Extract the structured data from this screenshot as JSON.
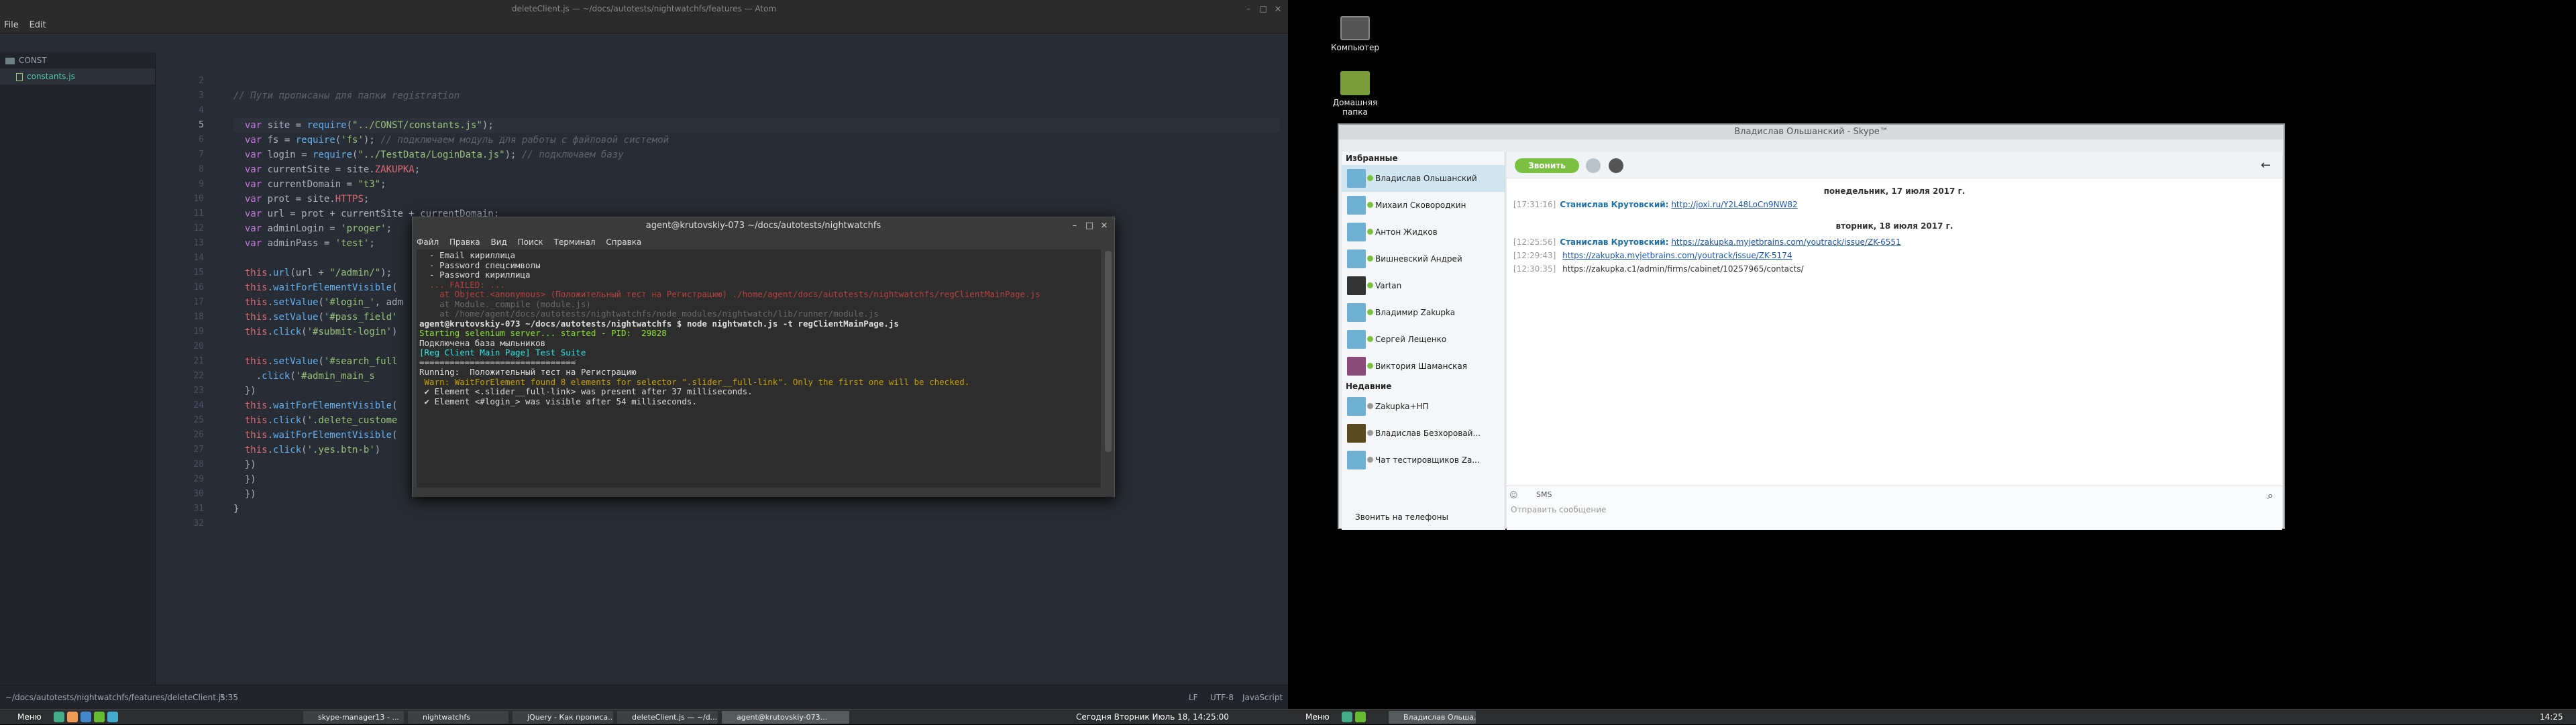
{
  "atom": {
    "title": "deleteClient.js — ~/docs/autotests/nightwatchfs/features — Atom",
    "menu": [
      "File",
      "Edit"
    ],
    "tree": {
      "folder": "CONST",
      "file": "constants.js"
    },
    "line_numbers": [
      "2",
      "3",
      "4",
      "5",
      "6",
      "7",
      "8",
      "9",
      "10",
      "11",
      "12",
      "13",
      "14",
      "15",
      "16",
      "17",
      "18",
      "19",
      "20",
      "21",
      "22",
      "23",
      "24",
      "25",
      "26",
      "27",
      "28",
      "29",
      "30",
      "31",
      "32"
    ],
    "status": {
      "path": "~/docs/autotests/nightwatchfs/features/deleteClient.js",
      "pos": "5:35",
      "eol": "LF",
      "enc": "UTF-8",
      "grammar": "JavaScript"
    }
  },
  "terminal": {
    "title": "agent@krutovskiy-073 ~/docs/autotests/nightwatchfs",
    "menu": [
      "Файл",
      "Правка",
      "Вид",
      "Поиск",
      "Терминал",
      "Справка"
    ],
    "lines": [
      "  - Email кириллица",
      "  - Password спецсимволы",
      "  - Password кириллица",
      "",
      "  ... FAILED: ...",
      "    at Object.<anonymous> (Положительный тест на Регистрацию) ./home/agent/docs/autotests/nightwatchfs/regClientMainPage.js",
      "",
      "    at Module._compile (module.js)",
      "    at /home/agent/docs/autotests/nightwatchfs/node_modules/nightwatch/lib/runner/module.js",
      "",
      "",
      "agent@krutovskiy-073 ~/docs/autotests/nightwatchfs $ node nightwatch.js -t regClientMainPage.js",
      "Starting selenium server... started - PID:  29828",
      "Подключена база мыльников",
      "",
      "[Reg Client Main Page] Test Suite",
      "===============================",
      "",
      "Running:  Положительный тест на Регистрацию",
      " Warn: WaitForElement found 8 elements for selector \".slider__full-link\". Only the first one will be checked.",
      " ✔ Element <.slider__full-link> was present after 37 milliseconds.",
      " ✔ Element <#login_> was visible after 54 milliseconds."
    ]
  },
  "desktop": {
    "icons": [
      {
        "label": "Компьютер"
      },
      {
        "label": "Домашняя папка"
      }
    ]
  },
  "skype": {
    "title": "Владислав Ольшанский - Skype™",
    "favorites_label": "Избранные",
    "recent_label": "Недавние",
    "favorites": [
      "Владислав Ольшанский",
      "Михаил Сковородкин",
      "Антон Жидков",
      "Вишневский Андрей",
      "Vartan",
      "Владимир Zakupka",
      "Сергей Лещенко",
      "Виктория Шаманская"
    ],
    "recent": [
      "Zakupka+НП",
      "Владислав Безхоровай...",
      "Чат тестировщиков Za..."
    ],
    "phone_button": "Звонить на телефоны",
    "call_button": "Звонить",
    "day1": "понедельник, 17 июля 2017 г.",
    "day2": "вторник, 18 июля 2017 г.",
    "messages": [
      {
        "time": "[17:31:16]",
        "name": "Станислав Крутовский:",
        "link": "http://joxi.ru/Y2L48LoCn9NW82"
      },
      {
        "time": "[12:25:56]",
        "name": "Станислав Крутовский:",
        "link": "https://zakupka.myjetbrains.com/youtrack/issue/ZK-6551"
      },
      {
        "time": "[12:29:43]",
        "name": "",
        "link": "https://zakupka.myjetbrains.com/youtrack/issue/ZK-5174"
      },
      {
        "time": "[12:30:35]",
        "name": "",
        "link": "https://zakupka.c1/admin/firms/cabinet/10257965/contacts/"
      }
    ],
    "sms": "SMS",
    "input_placeholder": "Отправить сообщение"
  },
  "taskbar_left": {
    "menu": "Меню",
    "tasks": [
      "skype-manager13 - ...",
      "nightwatchfs",
      "jQuery - Как прописа...",
      "deleteClient.js — ~/d...",
      "agent@krutovskiy-073..."
    ],
    "clock": "Сегодня Вторник Июль 18, 14:25:00"
  },
  "taskbar_right": {
    "menu": "Меню",
    "tasks": [
      "Владислав Ольша..."
    ],
    "clock": "14:25"
  }
}
